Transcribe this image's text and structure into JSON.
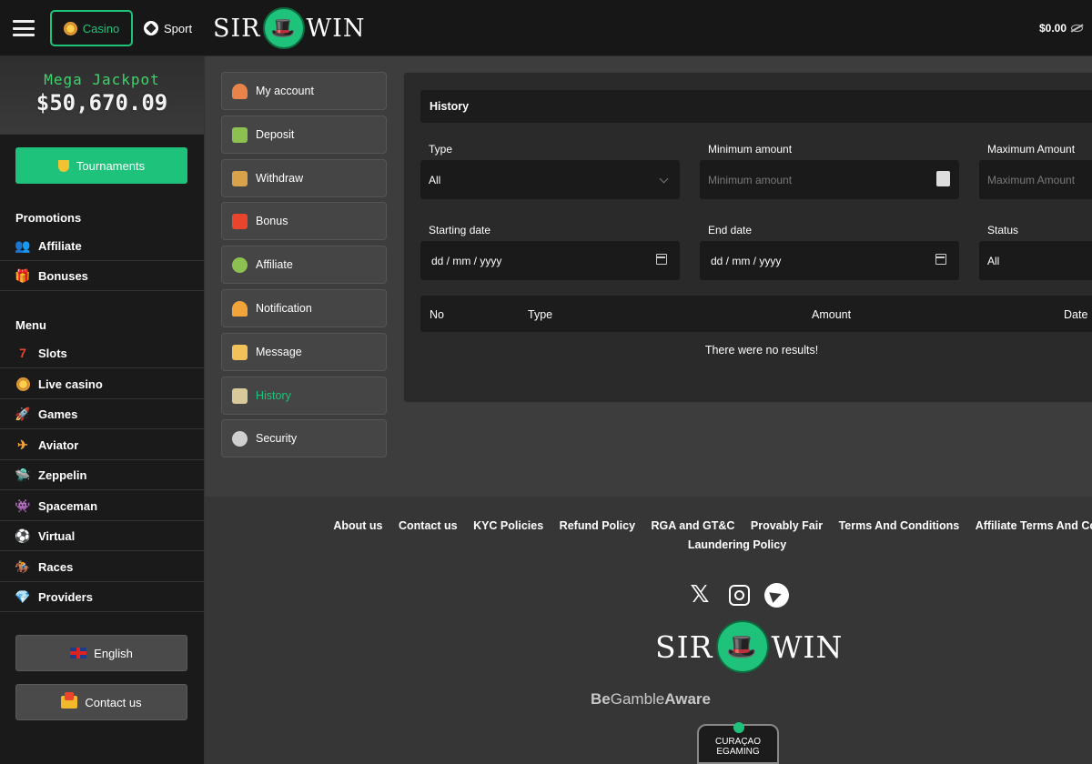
{
  "header": {
    "casino_label": "Casino",
    "sport_label": "Sport",
    "logo_left": "SIR",
    "logo_right": "WIN",
    "balance": "$0.00"
  },
  "jackpot": {
    "title": "Mega Jackpot",
    "value": "$50,670.09"
  },
  "sidebar": {
    "tournaments_label": "Tournaments",
    "promotions_title": "Promotions",
    "promotions": [
      {
        "label": "Affiliate",
        "icon": "affiliate-icon"
      },
      {
        "label": "Bonuses",
        "icon": "gift-icon"
      }
    ],
    "menu_title": "Menu",
    "menu": [
      {
        "label": "Slots",
        "icon": "slots-icon"
      },
      {
        "label": "Live casino",
        "icon": "chip-icon"
      },
      {
        "label": "Games",
        "icon": "rocket-icon"
      },
      {
        "label": "Aviator",
        "icon": "plane-icon"
      },
      {
        "label": "Zeppelin",
        "icon": "zeppelin-icon"
      },
      {
        "label": "Spaceman",
        "icon": "spaceman-icon"
      },
      {
        "label": "Virtual",
        "icon": "virtual-icon"
      },
      {
        "label": "Races",
        "icon": "horse-icon"
      },
      {
        "label": "Providers",
        "icon": "diamond-icon"
      }
    ],
    "language_label": "English",
    "contact_label": "Contact us"
  },
  "account_menu": [
    {
      "label": "My account",
      "icon": "user-icon",
      "color": "#e8834a"
    },
    {
      "label": "Deposit",
      "icon": "money-icon",
      "color": "#8cc152"
    },
    {
      "label": "Withdraw",
      "icon": "wallet-icon",
      "color": "#d9a24a"
    },
    {
      "label": "Bonus",
      "icon": "gift-icon",
      "color": "#e9452d"
    },
    {
      "label": "Affiliate",
      "icon": "affiliate-icon",
      "color": "#8cc152"
    },
    {
      "label": "Notification",
      "icon": "bell-icon",
      "color": "#f2a33a"
    },
    {
      "label": "Message",
      "icon": "envelope-icon",
      "color": "#f2c15a"
    },
    {
      "label": "History",
      "icon": "history-icon",
      "color": "#d8c89a",
      "active": true
    },
    {
      "label": "Security",
      "icon": "security-icon",
      "color": "#cfcfcf"
    }
  ],
  "history": {
    "title": "History",
    "type_label": "Type",
    "type_value": "All",
    "min_label": "Minimum amount",
    "min_placeholder": "Minimum amount",
    "max_label": "Maximum Amount",
    "max_placeholder": "Maximum Amount",
    "start_label": "Starting date",
    "start_placeholder": "dd / mm / yyyy",
    "end_label": "End date",
    "end_placeholder": "dd / mm / yyyy",
    "status_label": "Status",
    "status_value": "All",
    "columns": [
      "No",
      "Type",
      "Amount",
      "Date"
    ],
    "empty_text": "There were no results!"
  },
  "footer": {
    "links": [
      "About us",
      "Contact us",
      "KYC Policies",
      "Refund Policy",
      "RGA and GT&C",
      "Provably Fair",
      "Terms And Conditions",
      "Affiliate Terms And Conditions",
      "Laundering Policy"
    ],
    "gamble_prefix": "Be",
    "gamble_mid": "Gamble",
    "gamble_suffix": "Aware",
    "seal_line1": "CURAÇAO",
    "seal_line2": "EGAMING"
  },
  "colors": {
    "accent": "#1ec27a"
  }
}
